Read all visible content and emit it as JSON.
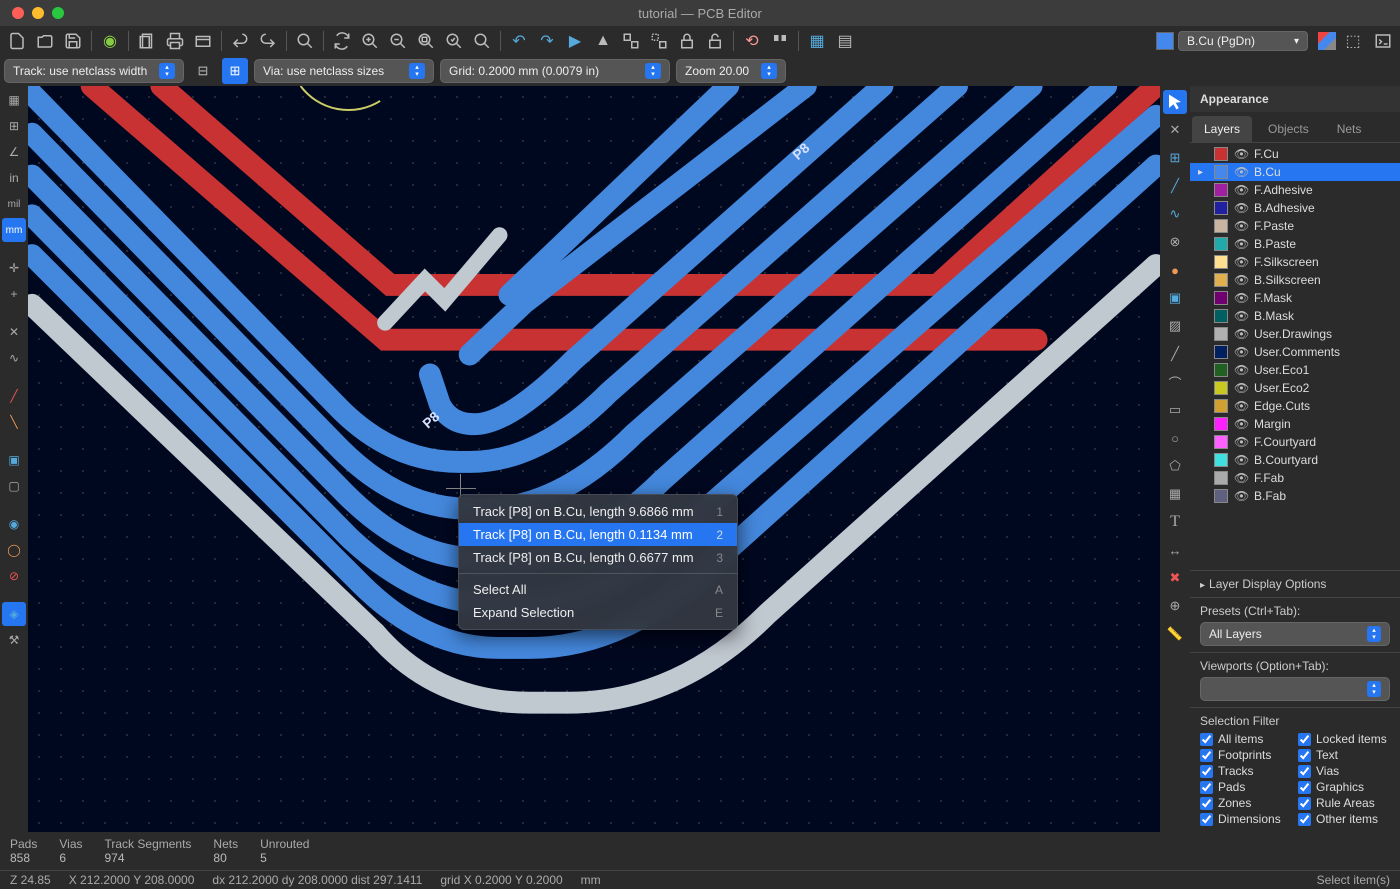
{
  "window": {
    "title": "tutorial — PCB Editor"
  },
  "toolbar2": {
    "track_width": "Track: use netclass width",
    "via_size": "Via: use netclass sizes",
    "grid": "Grid: 0.2000 mm (0.0079 in)",
    "zoom": "Zoom 20.00"
  },
  "layer_selector": {
    "active": "B.Cu (PgDn)"
  },
  "appearance": {
    "title": "Appearance",
    "tabs": [
      "Layers",
      "Objects",
      "Nets"
    ],
    "layers": [
      {
        "name": "F.Cu",
        "color": "#c83232"
      },
      {
        "name": "B.Cu",
        "color": "#4488ee",
        "current": true
      },
      {
        "name": "F.Adhesive",
        "color": "#a020a0"
      },
      {
        "name": "B.Adhesive",
        "color": "#2020a0"
      },
      {
        "name": "F.Paste",
        "color": "#c8b4a0"
      },
      {
        "name": "B.Paste",
        "color": "#20aaaa"
      },
      {
        "name": "F.Silkscreen",
        "color": "#ffe090"
      },
      {
        "name": "B.Silkscreen",
        "color": "#e0b050"
      },
      {
        "name": "F.Mask",
        "color": "#700070"
      },
      {
        "name": "B.Mask",
        "color": "#006060"
      },
      {
        "name": "User.Drawings",
        "color": "#b0b0b0"
      },
      {
        "name": "User.Comments",
        "color": "#002060"
      },
      {
        "name": "User.Eco1",
        "color": "#206020"
      },
      {
        "name": "User.Eco2",
        "color": "#c8c820"
      },
      {
        "name": "Edge.Cuts",
        "color": "#d0a030"
      },
      {
        "name": "Margin",
        "color": "#ff20ff"
      },
      {
        "name": "F.Courtyard",
        "color": "#ff60ff"
      },
      {
        "name": "B.Courtyard",
        "color": "#40e0e0"
      },
      {
        "name": "F.Fab",
        "color": "#aaaaaa"
      },
      {
        "name": "B.Fab",
        "color": "#606080"
      }
    ],
    "disp_options": "Layer Display Options",
    "presets_label": "Presets (Ctrl+Tab):",
    "presets_value": "All Layers",
    "viewports_label": "Viewports (Option+Tab):",
    "viewports_value": ""
  },
  "selection_filter": {
    "title": "Selection Filter",
    "items": [
      [
        "All items",
        "Locked items"
      ],
      [
        "Footprints",
        "Text"
      ],
      [
        "Tracks",
        "Vias"
      ],
      [
        "Pads",
        "Graphics"
      ],
      [
        "Zones",
        "Rule Areas"
      ],
      [
        "Dimensions",
        "Other items"
      ]
    ]
  },
  "ctxmenu": {
    "items": [
      {
        "label": "Track [P8] on B.Cu, length 9.6866 mm",
        "key": "1",
        "sel": false
      },
      {
        "label": "Track [P8] on B.Cu, length 0.1134 mm",
        "key": "2",
        "sel": true
      },
      {
        "label": "Track [P8] on B.Cu, length 0.6677 mm",
        "key": "3",
        "sel": false
      }
    ],
    "select_all": "Select All",
    "select_all_key": "A",
    "expand": "Expand Selection",
    "expand_key": "E"
  },
  "status": {
    "cols": [
      {
        "label": "Pads",
        "val": "858"
      },
      {
        "label": "Vias",
        "val": "6"
      },
      {
        "label": "Track Segments",
        "val": "974"
      },
      {
        "label": "Nets",
        "val": "80"
      },
      {
        "label": "Unrouted",
        "val": "5"
      }
    ],
    "z": "Z 24.85",
    "xy": "X 212.2000  Y 208.0000",
    "dxy": "dx 212.2000  dy 208.0000  dist 297.1411",
    "grid": "grid X 0.2000  Y 0.2000",
    "unit": "mm",
    "hint": "Select item(s)"
  },
  "canvas_label": "P8"
}
